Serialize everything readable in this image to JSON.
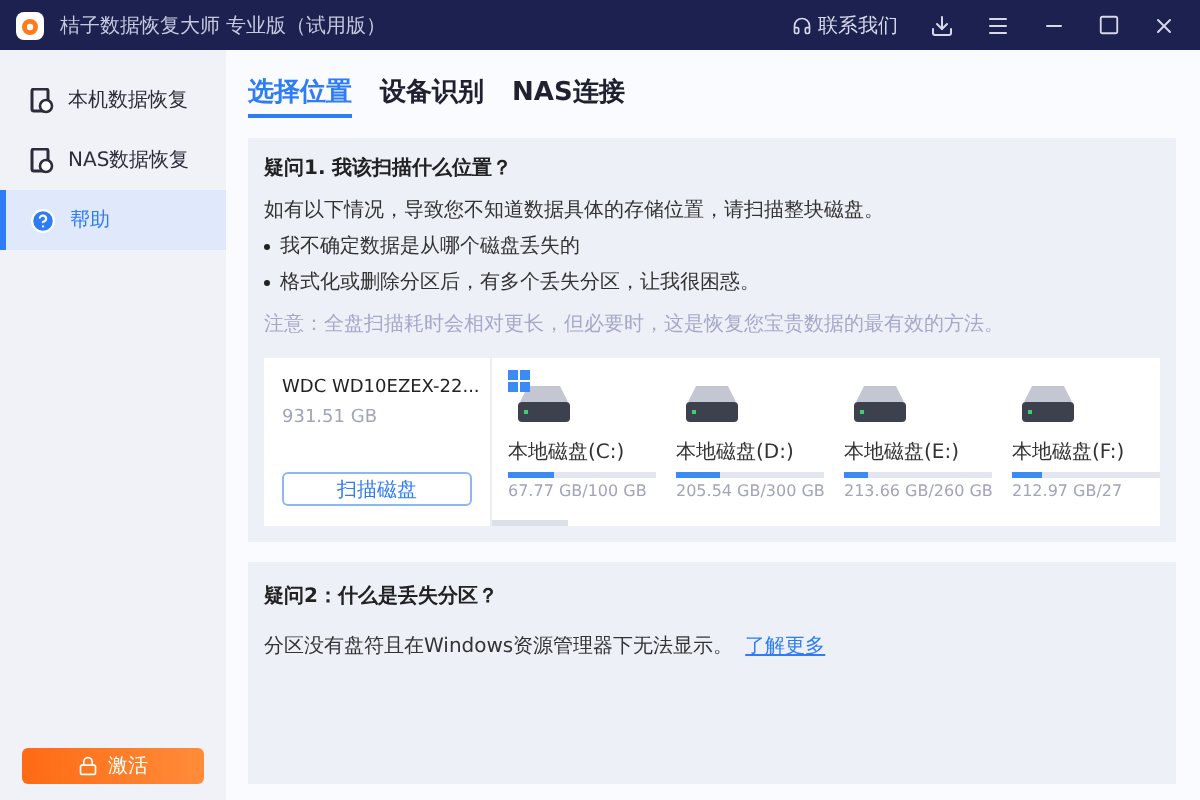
{
  "window": {
    "title": "桔子数据恢复大师 专业版（试用版）",
    "contact": "联系我们"
  },
  "sidebar": {
    "items": [
      {
        "label": "本机数据恢复",
        "kind": "drive",
        "selected": false
      },
      {
        "label": "NAS数据恢复",
        "kind": "drive",
        "selected": false
      },
      {
        "label": "帮助",
        "kind": "help",
        "selected": true
      }
    ],
    "activate_button": "激活"
  },
  "tabs": [
    {
      "label": "选择位置",
      "selected": true
    },
    {
      "label": "设备识别",
      "selected": false
    },
    {
      "label": "NAS连接",
      "selected": false
    }
  ],
  "faq1": {
    "question": "疑问1. 我该扫描什么位置？",
    "intro": "如有以下情况，导致您不知道数据具体的存储位置，请扫描整块磁盘。",
    "bullets": [
      "我不确定数据是从哪个磁盘丢失的",
      "格式化或删除分区后，有多个丢失分区，让我很困惑。"
    ],
    "note": "注意：全盘扫描耗时会相对更长，但必要时，这是恢复您宝贵数据的最有效的方法。",
    "disk": {
      "name": "WDC WD10EZEX-22...",
      "size": "931.51 GB",
      "scan_button": "扫描磁盘"
    },
    "partitions": [
      {
        "label": "本地磁盘(C:)",
        "usage": "67.77 GB/100 GB",
        "level": 0.31,
        "system": true
      },
      {
        "label": "本地磁盘(D:)",
        "usage": "205.54 GB/300 GB",
        "level": 0.3,
        "system": false
      },
      {
        "label": "本地磁盘(E:)",
        "usage": "213.66 GB/260 GB",
        "level": 0.16,
        "system": false
      },
      {
        "label": "本地磁盘(F:)",
        "usage": "212.97 GB/27",
        "level": 0.2,
        "system": false
      }
    ]
  },
  "faq2": {
    "question": "疑问2：什么是丢失分区？",
    "text": "分区没有盘符且在Windows资源管理器下无法显示。",
    "link": "了解更多"
  }
}
